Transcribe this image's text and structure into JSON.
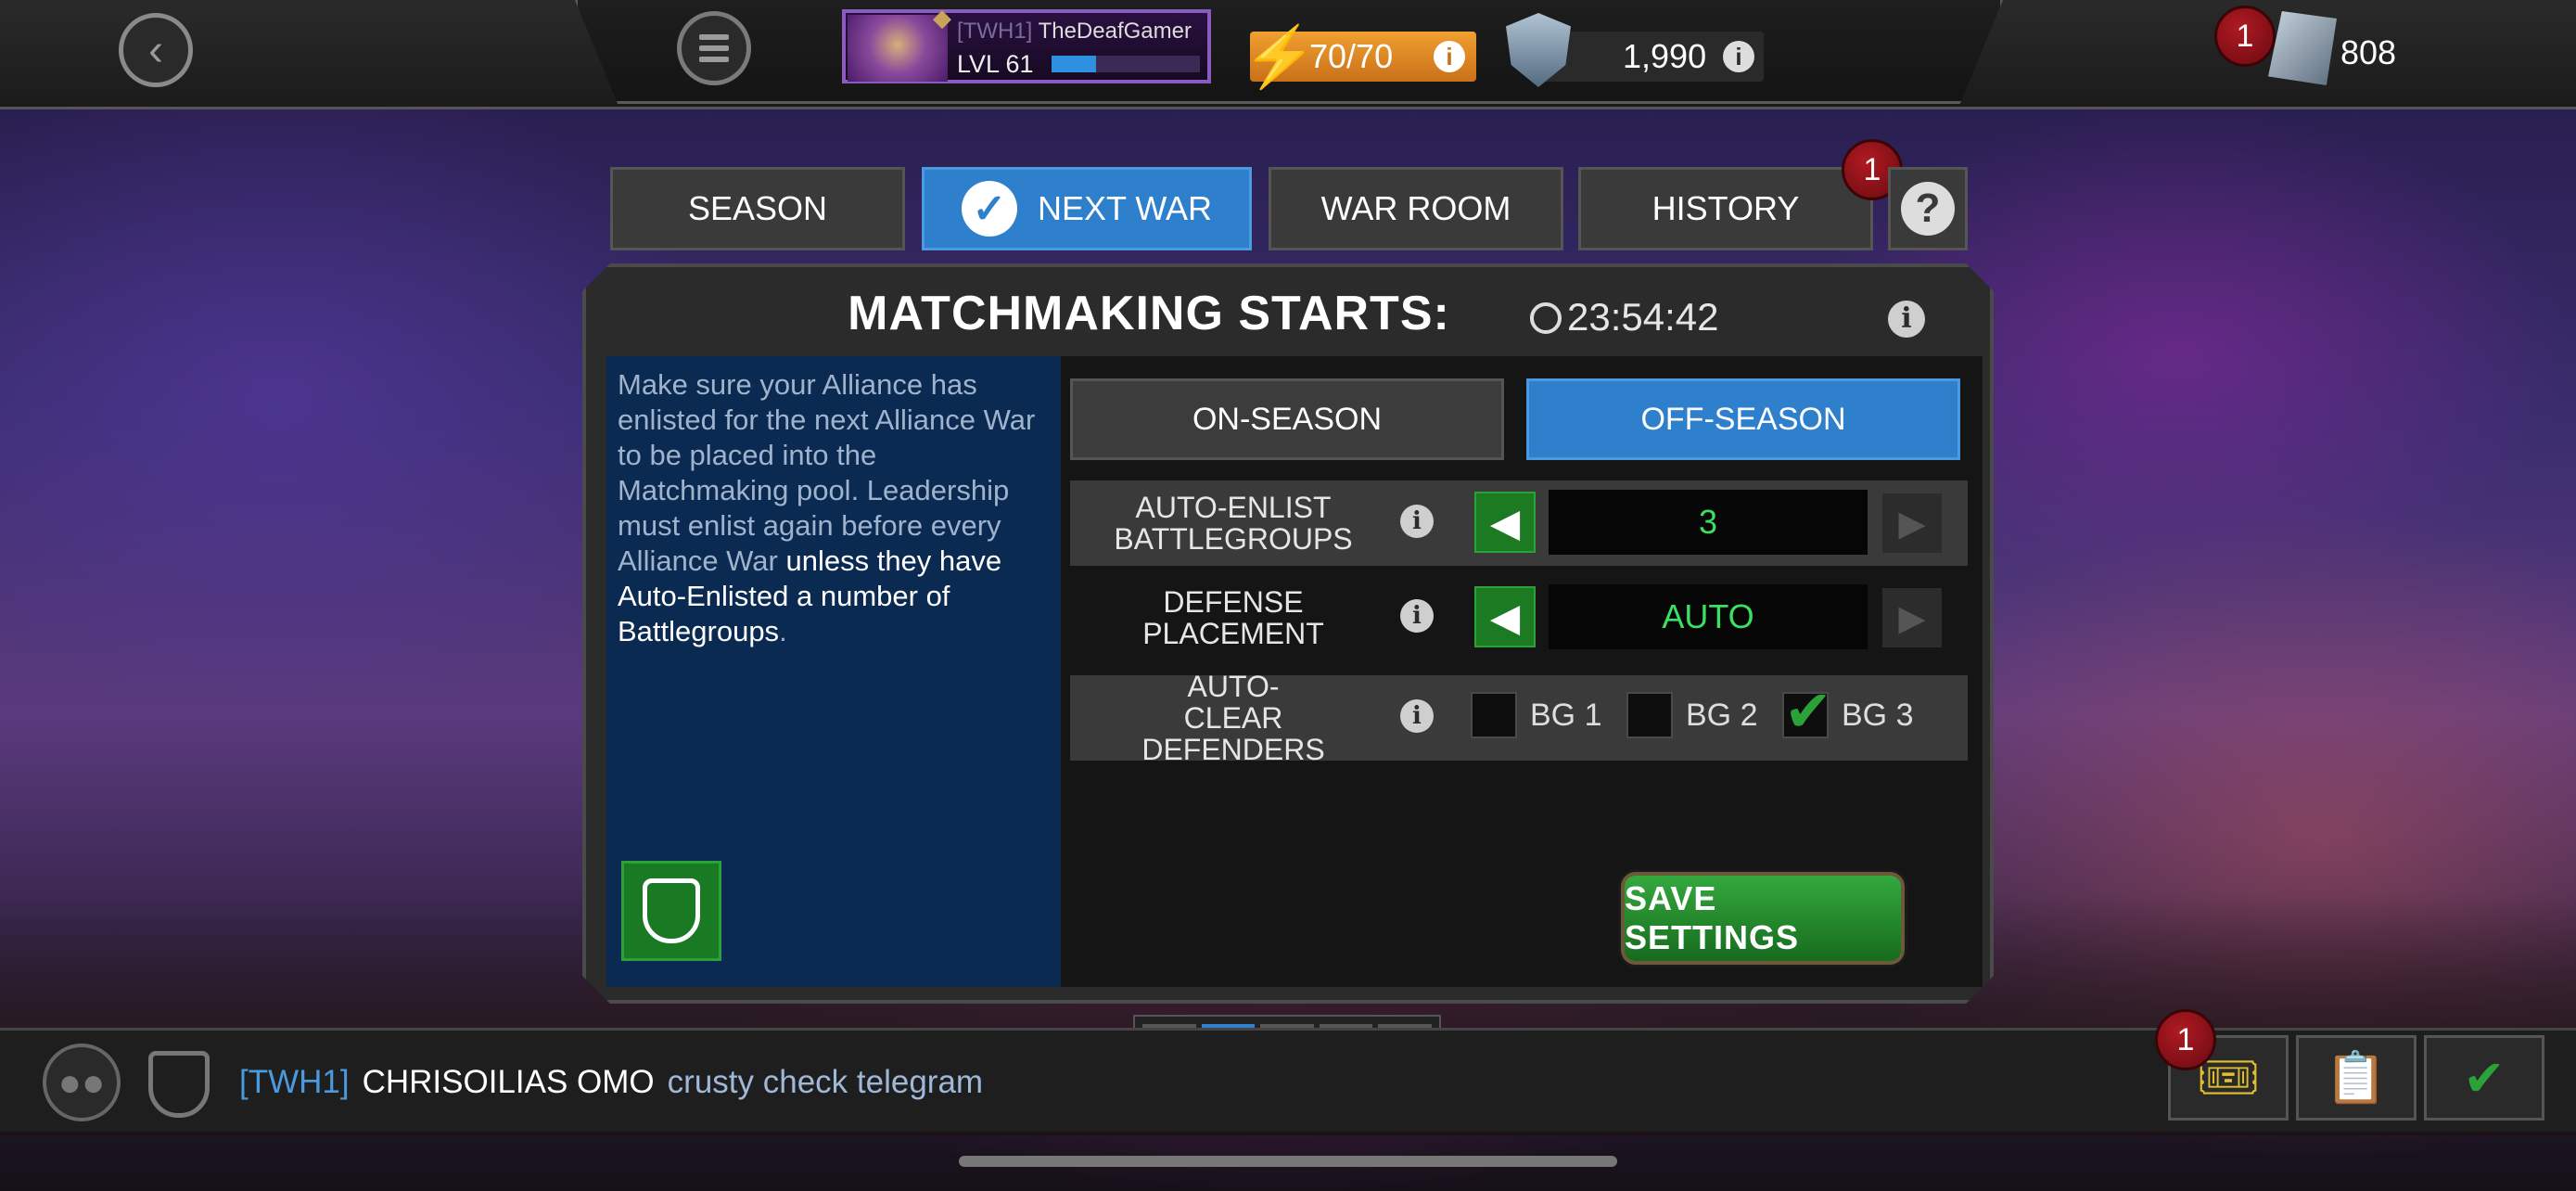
{
  "topbar": {
    "player_tag": "[TWH1]",
    "player_name": "TheDeafGamer",
    "level": "LVL 61",
    "xp_fraction": 0.3,
    "energy": "70/70",
    "war_points": "1,990",
    "rank_value": "808",
    "rank_badge": "1"
  },
  "tabs": [
    {
      "label": "SEASON",
      "active": false
    },
    {
      "label": "NEXT WAR",
      "active": true
    },
    {
      "label": "WAR ROOM",
      "active": false
    },
    {
      "label": "HISTORY",
      "active": false,
      "badge": "1"
    }
  ],
  "panel": {
    "title": "MATCHMAKING STARTS:",
    "timer": "23:54:42",
    "description_muted": "Make sure your Alliance has enlisted for the next Alliance War to be placed into the Matchmaking pool. Leadership must enlist again before every Alliance War",
    "description_highlight": "unless they have Auto-Enlisted a number of Battlegroups",
    "description_end": ".",
    "season_buttons": {
      "on": "ON-SEASON",
      "off": "OFF-SEASON",
      "selected": "OFF-SEASON"
    },
    "rows": {
      "auto_enlist": {
        "label": "AUTO-ENLIST BATTLEGROUPS",
        "value": "3"
      },
      "defense_placement": {
        "label": "DEFENSE PLACEMENT",
        "value": "AUTO"
      },
      "auto_clear": {
        "label": "AUTO-CLEAR DEFENDERS",
        "options": [
          {
            "label": "BG 1",
            "checked": false
          },
          {
            "label": "BG 2",
            "checked": false
          },
          {
            "label": "BG 3",
            "checked": true
          }
        ]
      }
    },
    "save_label": "SAVE SETTINGS"
  },
  "pager": {
    "pages": 5,
    "current": 2
  },
  "chat": {
    "tag": "[TWH1]",
    "user": "CHRISOILIAS OMO",
    "message": "crusty check telegram",
    "quest_badge": "1"
  },
  "icons": [
    "back-arrow-icon",
    "menu-icon",
    "energy-bolt-icon",
    "war-shield-icon",
    "rank-icon",
    "check-icon",
    "help-icon",
    "timer-icon",
    "info-icon",
    "alliance-emblem-icon",
    "friends-icon",
    "alliance-shield-icon",
    "quest-ticket-icon",
    "clipboard-icon",
    "completed-scroll-icon"
  ],
  "colors": {
    "accent_blue": "#2f80cc",
    "value_green": "#3ce060",
    "button_green": "#1c7a22",
    "badge_red": "#8a0f18",
    "energy_orange": "#e08a22"
  }
}
